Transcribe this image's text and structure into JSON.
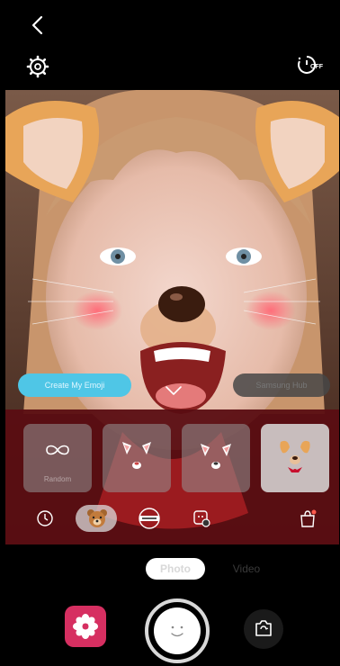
{
  "top": {
    "timer_state": "OFF"
  },
  "viewfinder": {
    "chip_create": "Create My Emoji",
    "chip_right": "Samsung Hub"
  },
  "stickers": {
    "items": [
      {
        "name": "Random",
        "label": "Random",
        "icon": "infinity-icon",
        "selected": false
      },
      {
        "name": "cat-face",
        "label": "",
        "icon": "cat-ears-icon",
        "selected": false
      },
      {
        "name": "fox-face",
        "label": "",
        "icon": "fox-ears-icon",
        "selected": false
      },
      {
        "name": "puppy-face",
        "label": "",
        "icon": "puppy-face-icon",
        "selected": true
      }
    ]
  },
  "categories": [
    "recent-icon",
    "bear-icon",
    "whats-up-icon",
    "effects-settings-icon",
    "store-icon"
  ],
  "modes": {
    "photo": "Photo",
    "video": "Video"
  },
  "colors": {
    "accent_create": "#4fc6e6",
    "gallery": "#d62f61"
  }
}
